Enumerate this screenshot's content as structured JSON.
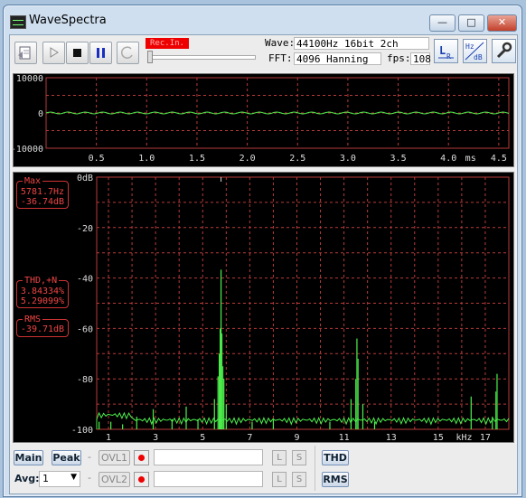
{
  "window": {
    "title": "WaveSpectra",
    "minimize_label": "—",
    "maximize_label": "□",
    "close_label": "✕"
  },
  "toolbar": {
    "rec_indicator": "Rec.In.",
    "wave_label": "Wave:",
    "wave_value": "44100Hz 16bit 2ch",
    "fft_label": "FFT:",
    "fft_value": "4096 Hanning",
    "fps_label": "fps:",
    "fps_value": "108"
  },
  "colors": {
    "trace": "#4cf04c",
    "grid": "#b83a3a",
    "readout": "#e44444",
    "plot_bg": "#000000"
  },
  "wave_panel": {
    "y_ticks": [
      "10000",
      "0",
      "-10000"
    ],
    "x_ticks": [
      "0.5",
      "1.0",
      "1.5",
      "2.0",
      "2.5",
      "3.0",
      "3.5",
      "4.0",
      "4.5"
    ],
    "x_unit": "ms"
  },
  "spectrum_panel": {
    "y_ticks": [
      "0dB",
      "-20",
      "-40",
      "-60",
      "-80",
      "-100"
    ],
    "x_ticks": [
      "1",
      "3",
      "5",
      "7",
      "9",
      "11",
      "13",
      "15",
      "17"
    ],
    "x_unit": "kHz"
  },
  "readouts": {
    "max_title": "Max",
    "max_freq": "5781.7Hz",
    "max_level": "-36.74dB",
    "thd_title": "THD,+N",
    "thd_value": "3.84334%",
    "thdn_value": "5.29099%",
    "rms_title": "RMS",
    "rms_value": "-39.71dB"
  },
  "chart_data": [
    {
      "type": "line",
      "ylim": [
        -10000,
        10000
      ],
      "xlim": [
        0,
        4.6
      ],
      "xlabel": "ms",
      "ylabel": "",
      "description_series": [
        {
          "x": [
            0,
            0.25,
            0.5,
            0.75,
            1.0,
            1.25,
            1.5,
            1.75,
            2.0,
            2.25,
            2.5,
            2.75,
            3.0,
            3.25,
            3.5,
            3.75,
            4.0,
            4.25,
            4.5
          ],
          "y": [
            0,
            0,
            0,
            0,
            0,
            0,
            0,
            0,
            0,
            0,
            0,
            0,
            0,
            0,
            0,
            0,
            0,
            0,
            0
          ]
        }
      ]
    },
    {
      "type": "line",
      "xlabel": "kHz",
      "ylabel": "",
      "ylim": [
        -100,
        0
      ],
      "xlim": [
        0.5,
        18.0
      ],
      "series": [
        {
          "x": [
            0.6,
            1.1,
            1.6,
            2.2,
            2.9,
            3.7,
            4.3,
            4.8,
            5.5,
            5.65,
            5.78,
            5.9,
            6.0,
            7.1,
            8.0,
            10.4,
            11.3,
            11.55,
            11.8,
            12.3,
            16.4,
            17.3,
            17.5
          ],
          "y": [
            -97,
            -97,
            -98,
            -95,
            -92,
            -96,
            -91,
            -96,
            -88,
            -79,
            -36.7,
            -80,
            -90,
            -97,
            -96,
            -97,
            -88,
            -64,
            -90,
            -97,
            -87,
            -95,
            -78
          ]
        }
      ]
    }
  ]
}
